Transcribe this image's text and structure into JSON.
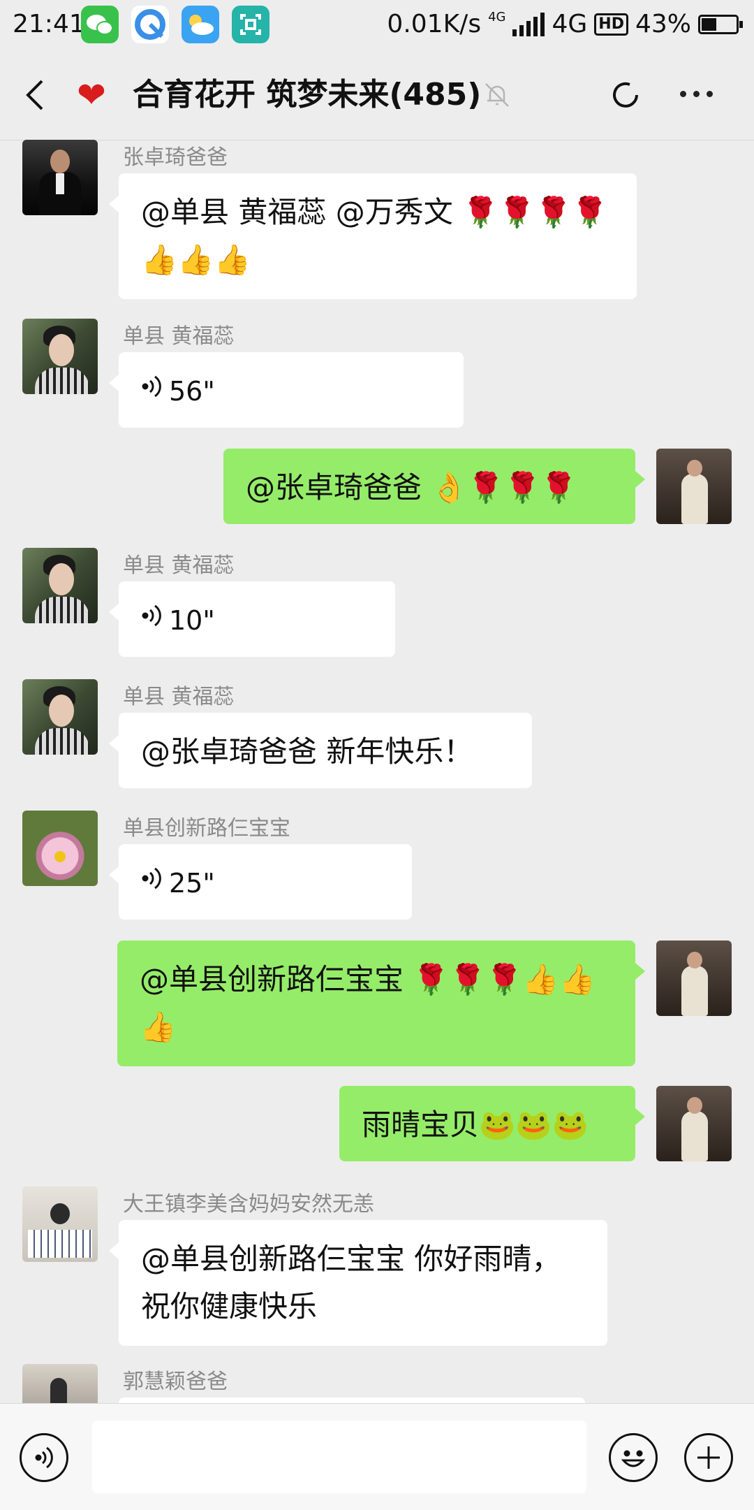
{
  "status_bar": {
    "time": "21:41",
    "net_speed": "0.01K/s",
    "network_small": "4G",
    "network": "4G",
    "hd": "HD",
    "battery": "43%",
    "apps": [
      "wechat-icon",
      "browser-icon",
      "weather-icon",
      "scan-icon"
    ],
    "colors": {
      "wechat": "#39c24b",
      "browser": "#3a8fe6",
      "weather": "#3aa3f2",
      "scan": "#26b3a8"
    }
  },
  "header": {
    "title": "合育花开 筑梦未来(485)",
    "icons": [
      "back-icon",
      "heart-icon",
      "mute-icon",
      "refresh-icon",
      "more-icon"
    ]
  },
  "messages": [
    {
      "side": "left",
      "sender": "张卓琦爸爸",
      "text": "@单县 黄福蕊 @万秀文 🌹🌹🌹🌹👍👍👍",
      "avatar": "dad"
    },
    {
      "side": "left",
      "sender": "单县 黄福蕊",
      "voice": "56\"",
      "avatar": "huang"
    },
    {
      "side": "right",
      "text": "@张卓琦爸爸 👌🌹🌹🌹",
      "avatar": "me"
    },
    {
      "side": "left",
      "sender": "单县 黄福蕊",
      "voice": "10\"",
      "avatar": "huang"
    },
    {
      "side": "left",
      "sender": "单县 黄福蕊",
      "text": "@张卓琦爸爸 新年快乐！",
      "avatar": "huang"
    },
    {
      "side": "left",
      "sender": "单县创新路仨宝宝",
      "voice": "25\"",
      "avatar": "flower"
    },
    {
      "side": "right",
      "text": "@单县创新路仨宝宝 🌹🌹🌹👍👍👍",
      "avatar": "me"
    },
    {
      "side": "right",
      "text": "雨晴宝贝🐸🐸🐸",
      "avatar": "me"
    },
    {
      "side": "left",
      "sender": "大王镇李美含妈妈安然无恙",
      "text": "@单县创新路仨宝宝 你好雨晴，祝你健康快乐",
      "avatar": "kid"
    },
    {
      "side": "left",
      "sender": "郭慧颖爸爸",
      "text": "",
      "avatar": "dance"
    }
  ],
  "input_bar": {
    "placeholder": "",
    "icons": [
      "voice-input-icon",
      "emoji-icon",
      "plus-icon"
    ]
  }
}
